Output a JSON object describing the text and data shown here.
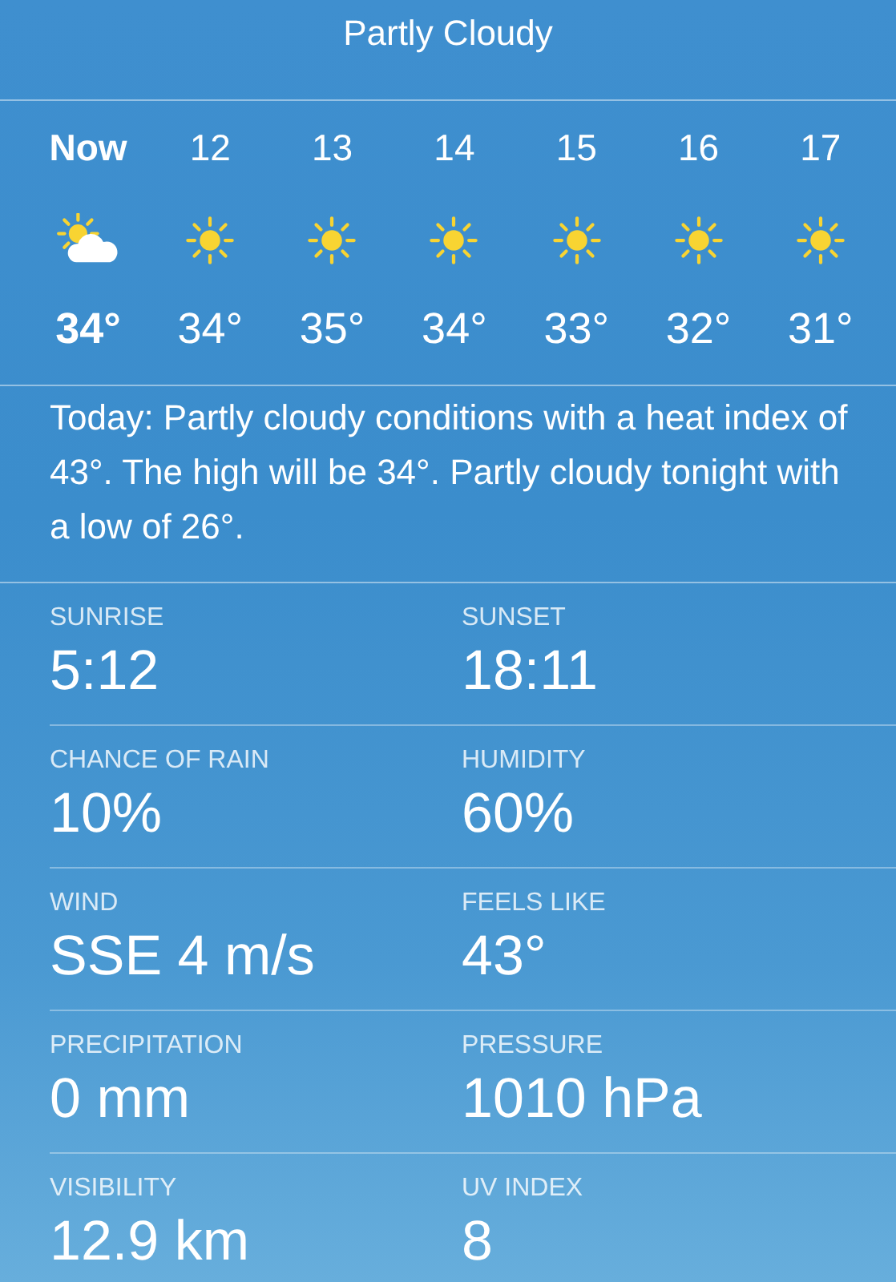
{
  "header": {
    "condition": "Partly Cloudy"
  },
  "hourly": [
    {
      "time": "Now",
      "current": true,
      "kind": "partly-cloudy",
      "temp": "34°"
    },
    {
      "time": "12",
      "current": false,
      "kind": "sunny",
      "temp": "34°"
    },
    {
      "time": "13",
      "current": false,
      "kind": "sunny",
      "temp": "35°"
    },
    {
      "time": "14",
      "current": false,
      "kind": "sunny",
      "temp": "34°"
    },
    {
      "time": "15",
      "current": false,
      "kind": "sunny",
      "temp": "33°"
    },
    {
      "time": "16",
      "current": false,
      "kind": "sunny",
      "temp": "32°"
    },
    {
      "time": "17",
      "current": false,
      "kind": "sunny",
      "temp": "31°"
    }
  ],
  "summary": "Today: Partly cloudy conditions with a heat index of 43°. The high will be 34°. Partly cloudy tonight with a low of 26°.",
  "details": [
    {
      "label": "SUNRISE",
      "value": "5:12"
    },
    {
      "label": "SUNSET",
      "value": "18:11"
    },
    {
      "label": "CHANCE OF RAIN",
      "value": "10%"
    },
    {
      "label": "HUMIDITY",
      "value": "60%"
    },
    {
      "label": "WIND",
      "value": "SSE 4 m/s"
    },
    {
      "label": "FEELS LIKE",
      "value": "43°"
    },
    {
      "label": "PRECIPITATION",
      "value": "0 mm"
    },
    {
      "label": "PRESSURE",
      "value": "1010 hPa"
    },
    {
      "label": "VISIBILITY",
      "value": "12.9 km"
    },
    {
      "label": "UV INDEX",
      "value": "8"
    }
  ]
}
